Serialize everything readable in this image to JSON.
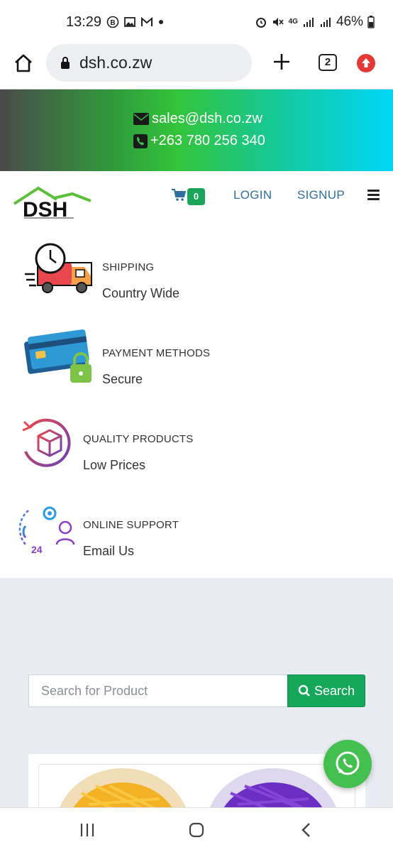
{
  "status_bar": {
    "time": "13:29",
    "battery": "46%",
    "network": "4G"
  },
  "browser": {
    "url": "dsh.co.zw",
    "tab_count": "2"
  },
  "contact": {
    "email": "sales@dsh.co.zw",
    "phone": "+263 780 256 340"
  },
  "header": {
    "logo_text": "DSH",
    "cart_count": "0",
    "login_label": "LOGIN",
    "signup_label": "SIGNUP"
  },
  "features": [
    {
      "title": "SHIPPING",
      "subtitle": "Country Wide",
      "icon": "delivery-truck-icon"
    },
    {
      "title": "PAYMENT METHODS",
      "subtitle": "Secure",
      "icon": "credit-card-lock-icon"
    },
    {
      "title": "QUALITY PRODUCTS",
      "subtitle": "Low Prices",
      "icon": "return-box-icon"
    },
    {
      "title": "ONLINE SUPPORT",
      "subtitle": "Email Us",
      "icon": "support-24-icon"
    }
  ],
  "search": {
    "placeholder": "Search for Product",
    "button_label": "Search"
  },
  "colors": {
    "accent_green": "#16a85a",
    "nav_blue": "#2f6f9f",
    "whatsapp_green": "#43c04f"
  }
}
